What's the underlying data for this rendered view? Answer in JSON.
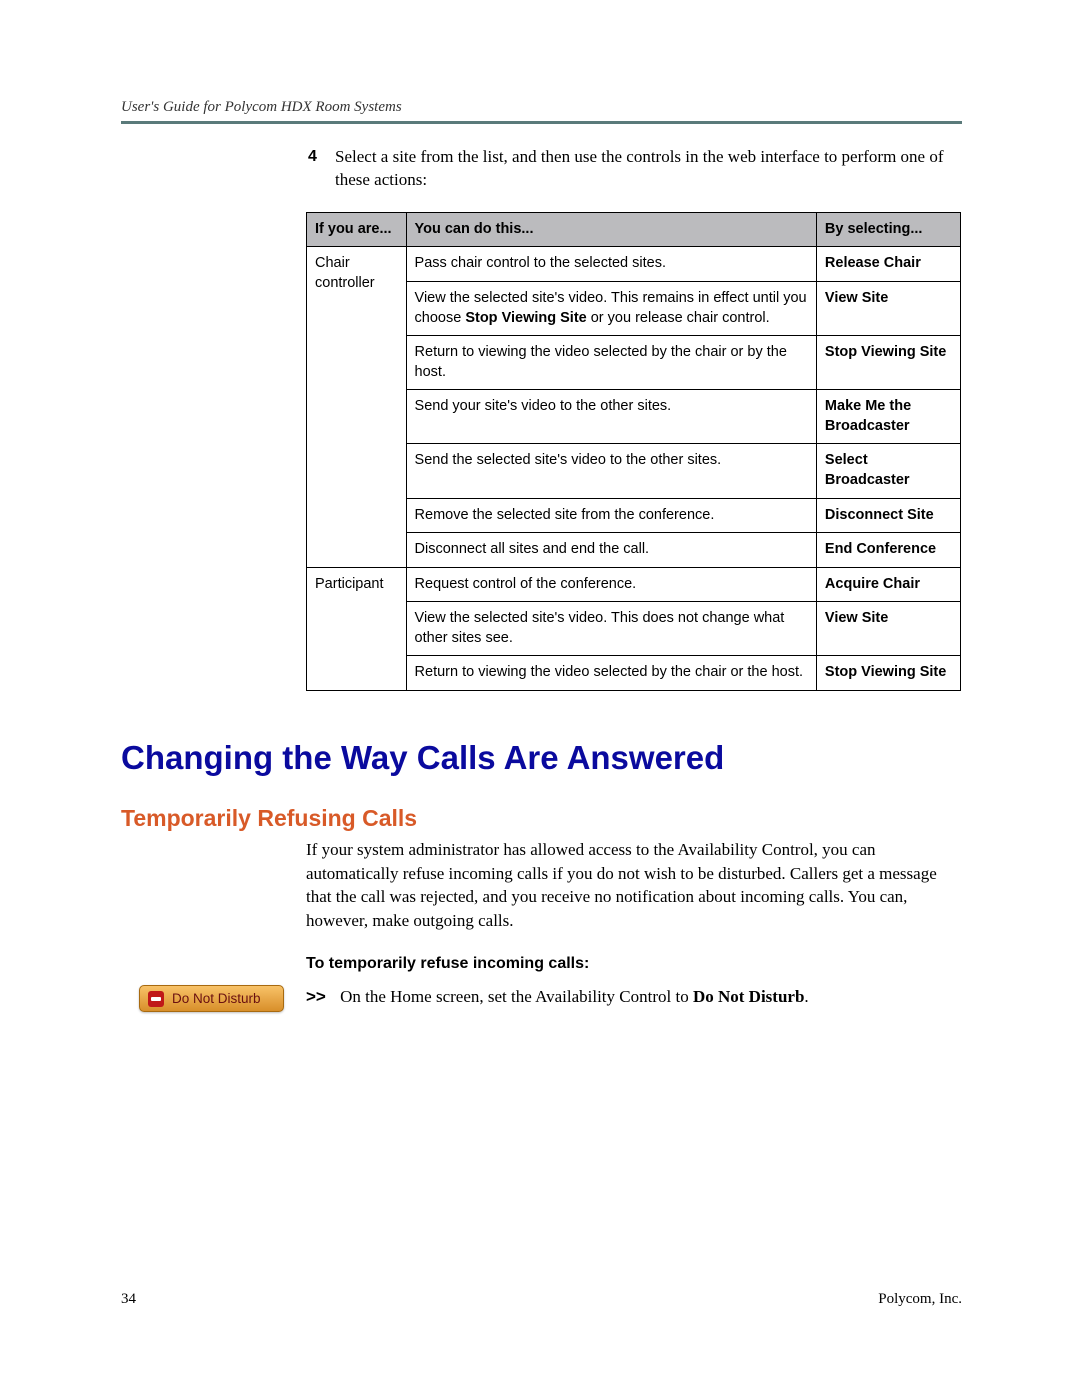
{
  "header": "User's Guide for Polycom HDX Room Systems",
  "step": {
    "number": "4",
    "text_a": "Select a site from the list, and then use the controls in the web interface to perform one of these actions:"
  },
  "table": {
    "headers": {
      "c1": "If you are...",
      "c2": "You can do this...",
      "c3": "By selecting..."
    },
    "role1": "Chair controller",
    "role2": "Participant",
    "r1": {
      "a": "Pass chair control to the selected sites.",
      "b": "Release Chair"
    },
    "r2": {
      "a1": "View the selected site's video. This remains in effect until you choose ",
      "a2": "Stop Viewing Site",
      "a3": " or you release chair control.",
      "b": "View Site"
    },
    "r3": {
      "a": "Return to viewing the video selected by the chair or by the host.",
      "b": "Stop Viewing Site"
    },
    "r4": {
      "a": "Send your site's video to the other sites.",
      "b": "Make Me the Broadcaster"
    },
    "r5": {
      "a": "Send the selected site's video to the other sites.",
      "b": "Select Broadcaster"
    },
    "r6": {
      "a": "Remove the selected site from the conference.",
      "b": "Disconnect Site"
    },
    "r7": {
      "a": "Disconnect all sites and end the call.",
      "b": "End Conference"
    },
    "p1": {
      "a": "Request control of the conference.",
      "b": "Acquire Chair"
    },
    "p2": {
      "a": "View the selected site's video. This does not change what other sites see.",
      "b": "View Site"
    },
    "p3": {
      "a": "Return to viewing the video selected by the chair or the host.",
      "b": "Stop Viewing Site"
    }
  },
  "h1": "Changing the Way Calls Are Answered",
  "h2": "Temporarily Refusing Calls",
  "para": "If your system administrator has allowed access to the Availability Control, you can automatically refuse incoming calls if you do not wish to be disturbed. Callers get a message that the call was rejected, and you receive no notification about incoming calls. You can, however, make outgoing calls.",
  "subhead": "To temporarily refuse incoming calls:",
  "dnd_label": "Do Not Disturb",
  "step_arrow": ">>",
  "step_text_a": "On the Home screen, set the Availability Control to ",
  "step_text_b": "Do Not Disturb",
  "step_text_c": ".",
  "footer": {
    "left": "34",
    "right": "Polycom, Inc."
  }
}
